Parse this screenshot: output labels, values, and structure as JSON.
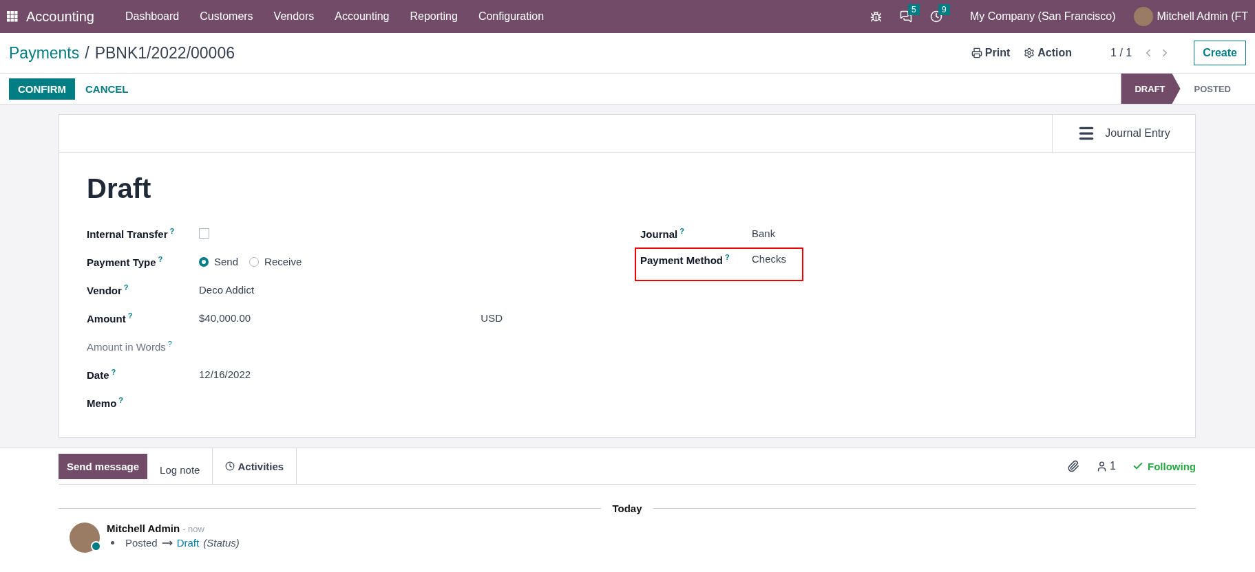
{
  "navbar": {
    "app_name": "Accounting",
    "menu": [
      "Dashboard",
      "Customers",
      "Vendors",
      "Accounting",
      "Reporting",
      "Configuration"
    ],
    "messages_badge": "5",
    "activities_badge": "9",
    "company": "My Company (San Francisco)",
    "user": "Mitchell Admin (FT"
  },
  "breadcrumb": {
    "parent": "Payments",
    "separator": "/",
    "current": "PBNK1/2022/00006"
  },
  "control_panel": {
    "print": "Print",
    "action": "Action",
    "pager": "1 / 1",
    "create": "Create"
  },
  "actions": [
    {
      "label": "CONFIRM",
      "kind": "primary"
    },
    {
      "label": "CANCEL",
      "kind": "link"
    }
  ],
  "status_bar": [
    {
      "label": "DRAFT",
      "selected": true
    },
    {
      "label": "POSTED",
      "selected": false
    }
  ],
  "sheet": {
    "smart_button": "Journal Entry",
    "title": "Draft",
    "left_fields": [
      {
        "label": "Internal Transfer",
        "help": "?",
        "kind": "checkbox",
        "checked": false
      },
      {
        "label": "Payment Type",
        "help": "?",
        "kind": "radio",
        "options": [
          {
            "label": "Send",
            "selected": true
          },
          {
            "label": "Receive",
            "selected": false
          }
        ]
      },
      {
        "label": "Vendor",
        "help": "?",
        "kind": "text",
        "value": "Deco Addict"
      },
      {
        "label": "Amount",
        "help": "?",
        "kind": "amount",
        "value": "$40,000.00",
        "currency": "USD"
      },
      {
        "label": "Amount in Words",
        "help": "?",
        "kind": "empty",
        "muted": true
      },
      {
        "label": "Date",
        "help": "?",
        "kind": "text",
        "value": "12/16/2022"
      },
      {
        "label": "Memo",
        "help": "?",
        "kind": "empty"
      }
    ],
    "right_fields": [
      {
        "label": "Journal",
        "help": "?",
        "kind": "text",
        "value": "Bank",
        "highlighted": false
      },
      {
        "label": "Payment Method",
        "help": "?",
        "kind": "text",
        "value": "Checks",
        "highlighted": true
      }
    ]
  },
  "chatter": {
    "buttons": [
      {
        "label": "Send message",
        "kind": "primary"
      },
      {
        "label": "Log note",
        "kind": "tab"
      },
      {
        "label": "Activities",
        "kind": "icon-tab"
      }
    ],
    "followers": "1",
    "following": "Following",
    "day": "Today",
    "messages": [
      {
        "author": "Mitchell Admin",
        "time": "- now",
        "old_value": "Posted",
        "new_value": "Draft",
        "field": "(Status)"
      }
    ]
  }
}
